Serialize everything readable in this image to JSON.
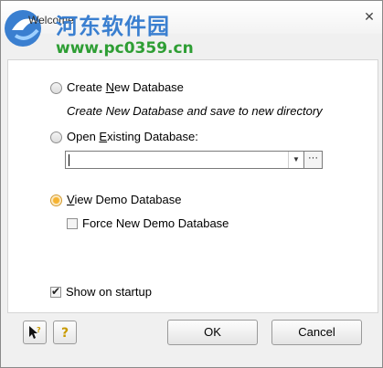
{
  "window": {
    "title": "Welcome",
    "close_symbol": "✕"
  },
  "watermark": {
    "cn_text": "河东软件园",
    "url": "www.pc0359.cn"
  },
  "options": {
    "create": {
      "label_prefix": "Create ",
      "label_underline": "N",
      "label_suffix": "ew Database",
      "description": "Create New Database and save to new directory",
      "selected": false
    },
    "open": {
      "label_prefix": "Open ",
      "label_underline": "E",
      "label_suffix": "xisting Database:",
      "selected": false,
      "path_value": ""
    },
    "demo": {
      "label_prefix": "",
      "label_underline": "V",
      "label_suffix": "iew Demo Database",
      "selected": true
    },
    "force_new_demo": {
      "label": "Force New Demo Database",
      "checked": false
    }
  },
  "browse_label": "···",
  "show_on_startup": {
    "label": "Show on startup",
    "checked": true
  },
  "buttons": {
    "ok": "OK",
    "cancel": "Cancel"
  },
  "icons": {
    "whats_this": "pointer-help-icon",
    "help": "help-icon"
  },
  "colors": {
    "watermark_blue": "#3a7fd0",
    "watermark_green": "#2e9e34",
    "radio_selected": "#f6b331"
  }
}
